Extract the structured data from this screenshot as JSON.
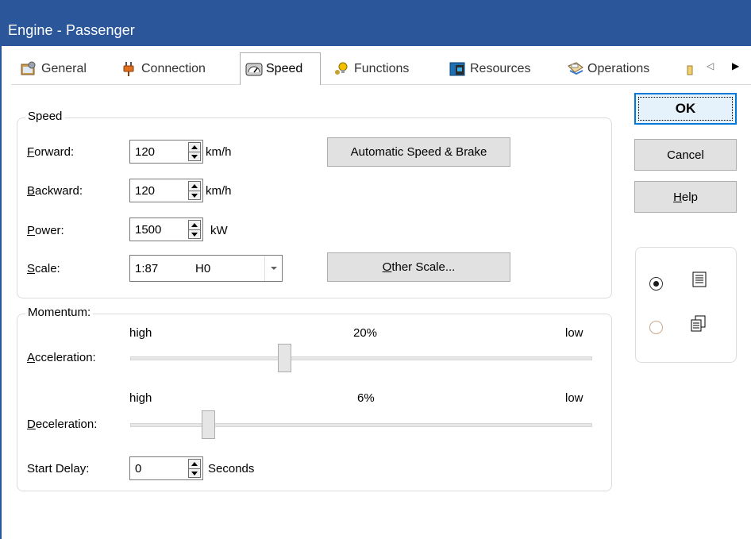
{
  "window": {
    "title": "Engine - Passenger"
  },
  "tabs": [
    {
      "label": "General",
      "icon": "general-settings-icon",
      "active": false
    },
    {
      "label": "Connection",
      "icon": "plug-icon",
      "active": false
    },
    {
      "label": "Speed",
      "icon": "speedometer-icon",
      "active": true
    },
    {
      "label": "Functions",
      "icon": "lightbulb-icon",
      "active": false
    },
    {
      "label": "Resources",
      "icon": "resources-icon",
      "active": false
    },
    {
      "label": "Operations",
      "icon": "operations-icon",
      "active": false
    }
  ],
  "speed_group": {
    "caption": "Speed",
    "forward": {
      "label_prefix": "",
      "accel": "F",
      "label_rest": "orward:",
      "value": "120",
      "unit": "km/h"
    },
    "backward": {
      "accel": "B",
      "label_rest": "ackward:",
      "value": "120",
      "unit": "km/h"
    },
    "power": {
      "accel": "P",
      "label_rest": "ower:",
      "value": "1500",
      "unit": "kW"
    },
    "scale": {
      "accel": "S",
      "label_rest": "cale:",
      "value_ratio": "1:87",
      "value_name": "H0"
    },
    "auto_button": "Automatic Speed & Brake",
    "other_scale_button": {
      "accel": "O",
      "rest": "ther Scale..."
    }
  },
  "momentum_group": {
    "caption": "Momentum:",
    "acceleration": {
      "accel": "A",
      "label_rest": "cceleration:",
      "left": "high",
      "right": "low",
      "value_text": "20%",
      "value": 0.33
    },
    "deceleration": {
      "accel": "D",
      "label_rest": "eceleration:",
      "left": "high",
      "right": "low",
      "value_text": "6%",
      "value": 0.16
    },
    "start_delay": {
      "label": "Start Delay:",
      "value": "0",
      "unit": "Seconds"
    }
  },
  "buttons": {
    "ok": "OK",
    "cancel": "Cancel",
    "help_accel": "H",
    "help_rest": "elp"
  },
  "view_options": [
    {
      "icon": "list-view-icon",
      "checked": true
    },
    {
      "icon": "copy-view-icon",
      "checked": false
    }
  ],
  "colors": {
    "titlebar": "#2b579a",
    "accent": "#0078d7"
  }
}
